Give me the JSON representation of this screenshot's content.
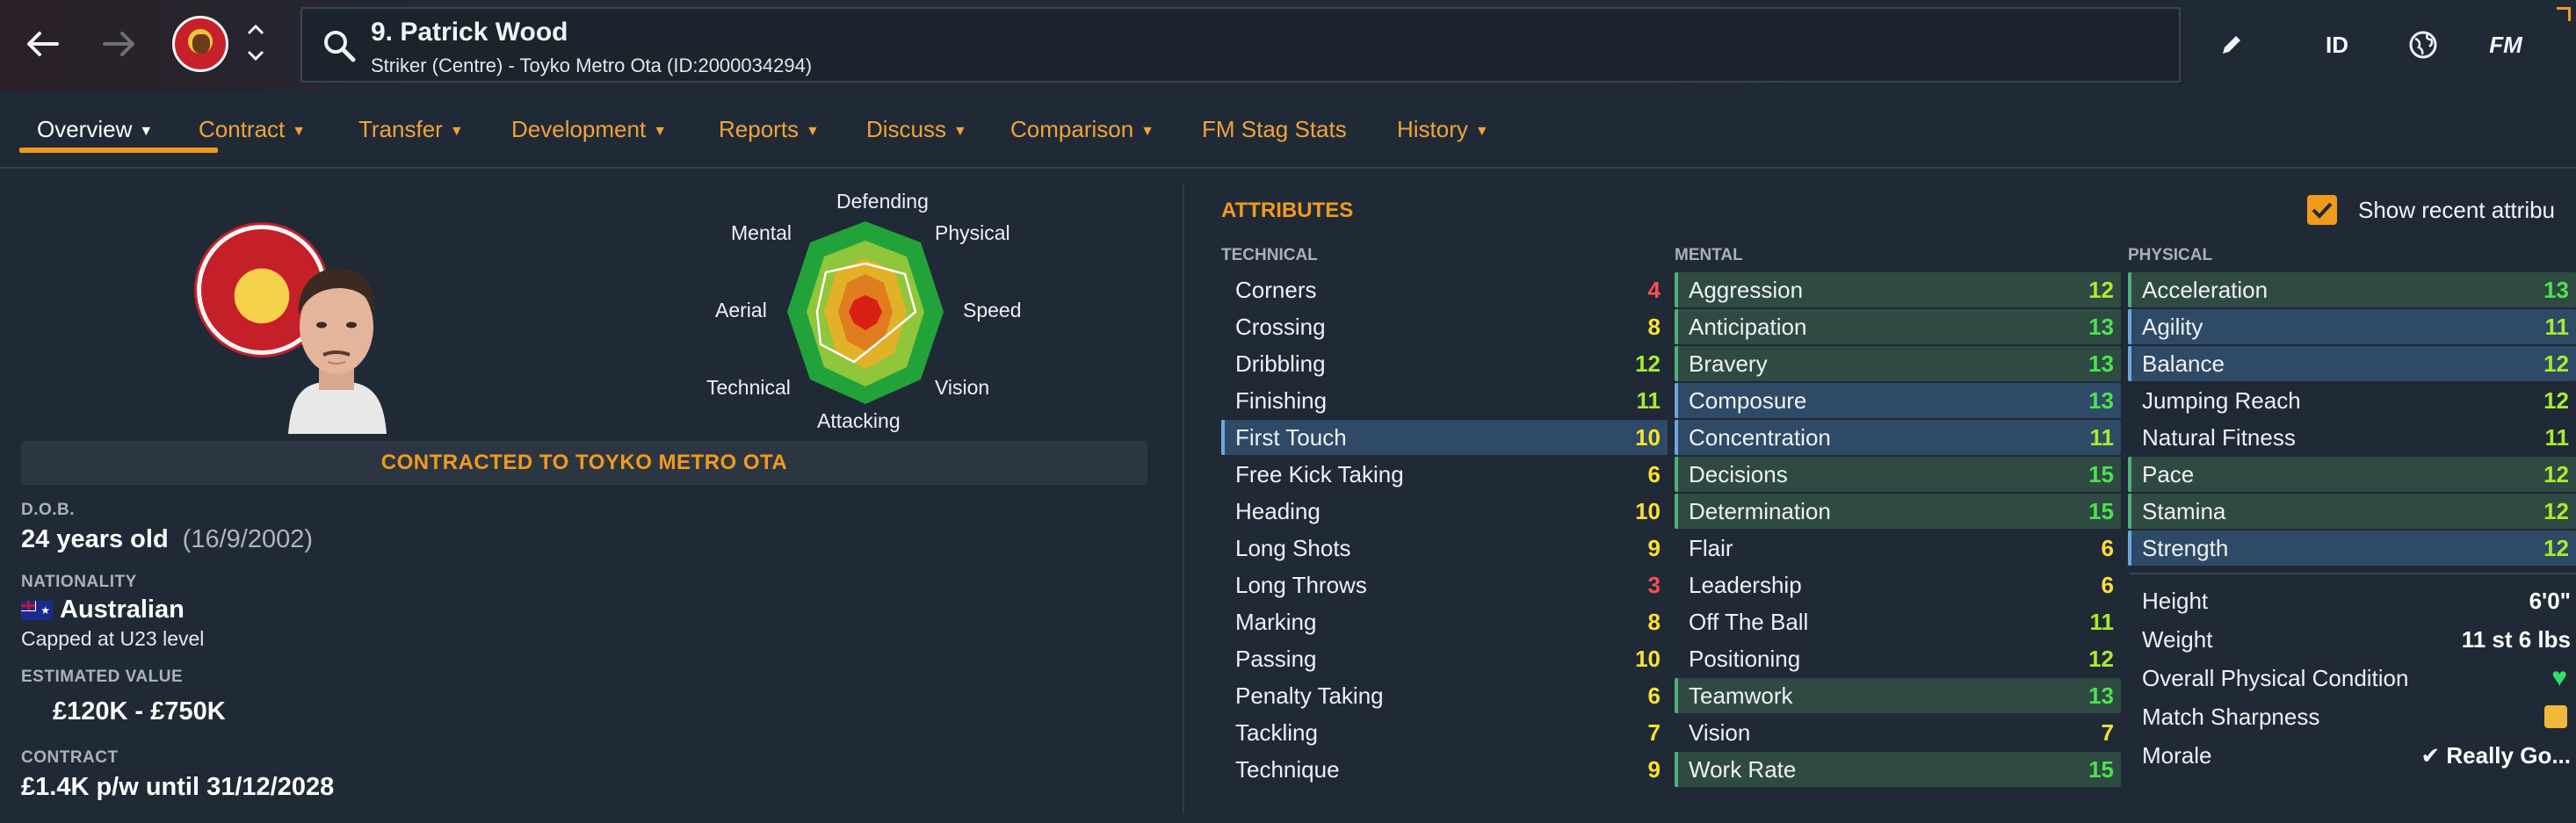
{
  "header": {
    "player_name": "9. Patrick Wood",
    "player_subtitle": "Striker (Centre) - Toyko Metro Ota (ID:2000034294)",
    "tools": {
      "id_label": "ID",
      "fm_label": "FM"
    },
    "icons": [
      "back-arrow-icon",
      "forward-arrow-icon",
      "club-badge",
      "chevron-up-icon",
      "chevron-down-icon",
      "search-icon",
      "pencil-icon",
      "globe-icon"
    ]
  },
  "tabs": [
    {
      "label": "Overview",
      "active": true
    },
    {
      "label": "Contract"
    },
    {
      "label": "Transfer"
    },
    {
      "label": "Development"
    },
    {
      "label": "Reports"
    },
    {
      "label": "Discuss"
    },
    {
      "label": "Comparison"
    },
    {
      "label": "FM Stag Stats"
    },
    {
      "label": "History"
    }
  ],
  "radar": {
    "labels": {
      "defending": "Defending",
      "physical": "Physical",
      "speed": "Speed",
      "vision": "Vision",
      "attacking": "Attacking",
      "technical": "Technical",
      "aerial": "Aerial",
      "mental": "Mental"
    }
  },
  "profile": {
    "contract_banner": "CONTRACTED TO TOYKO METRO OTA",
    "dob_label": "D.O.B.",
    "age": "24 years old",
    "dob": "(16/9/2002)",
    "nationality_label": "NATIONALITY",
    "nationality": "Australian",
    "caps": "Capped at U23 level",
    "value_label": "ESTIMATED VALUE",
    "value": "£120K - £750K",
    "contract_label": "CONTRACT",
    "contract": "£1.4K p/w until 31/12/2028"
  },
  "attributes": {
    "title": "ATTRIBUTES",
    "show_recent_label": "Show recent attribu",
    "show_recent_checked": true,
    "technical_label": "TECHNICAL",
    "mental_label": "MENTAL",
    "physical_label": "PHYSICAL",
    "technical": [
      {
        "name": "Corners",
        "value": "4"
      },
      {
        "name": "Crossing",
        "value": "8"
      },
      {
        "name": "Dribbling",
        "value": "12"
      },
      {
        "name": "Finishing",
        "value": "11"
      },
      {
        "name": "First Touch",
        "value": "10"
      },
      {
        "name": "Free Kick Taking",
        "value": "6"
      },
      {
        "name": "Heading",
        "value": "10"
      },
      {
        "name": "Long Shots",
        "value": "9"
      },
      {
        "name": "Long Throws",
        "value": "3"
      },
      {
        "name": "Marking",
        "value": "8"
      },
      {
        "name": "Passing",
        "value": "10"
      },
      {
        "name": "Penalty Taking",
        "value": "6"
      },
      {
        "name": "Tackling",
        "value": "7"
      },
      {
        "name": "Technique",
        "value": "9"
      }
    ],
    "mental": [
      {
        "name": "Aggression",
        "value": "12"
      },
      {
        "name": "Anticipation",
        "value": "13"
      },
      {
        "name": "Bravery",
        "value": "13"
      },
      {
        "name": "Composure",
        "value": "13"
      },
      {
        "name": "Concentration",
        "value": "11"
      },
      {
        "name": "Decisions",
        "value": "15"
      },
      {
        "name": "Determination",
        "value": "15"
      },
      {
        "name": "Flair",
        "value": "6"
      },
      {
        "name": "Leadership",
        "value": "6"
      },
      {
        "name": "Off The Ball",
        "value": "11"
      },
      {
        "name": "Positioning",
        "value": "12"
      },
      {
        "name": "Teamwork",
        "value": "13"
      },
      {
        "name": "Vision",
        "value": "7"
      },
      {
        "name": "Work Rate",
        "value": "15"
      }
    ],
    "physical": [
      {
        "name": "Acceleration",
        "value": "13"
      },
      {
        "name": "Agility",
        "value": "11"
      },
      {
        "name": "Balance",
        "value": "12"
      },
      {
        "name": "Jumping Reach",
        "value": "12"
      },
      {
        "name": "Natural Fitness",
        "value": "11"
      },
      {
        "name": "Pace",
        "value": "12"
      },
      {
        "name": "Stamina",
        "value": "12"
      },
      {
        "name": "Strength",
        "value": "12"
      }
    ],
    "physical_info": [
      {
        "name": "Height",
        "value": "6'0\""
      },
      {
        "name": "Weight",
        "value": "11 st 6 lbs"
      },
      {
        "name": "Overall Physical Condition",
        "value": ""
      },
      {
        "name": "Match Sharpness",
        "value": ""
      },
      {
        "name": "Morale",
        "value": "Really Go..."
      }
    ]
  },
  "colors": {
    "accent": "#f29a1a",
    "background": "#1f2a36",
    "value_red": "#ff4f4f",
    "value_yellow": "#ffe033",
    "value_light_green": "#a9ec2e",
    "value_green": "#4be34f",
    "highlight_blue": "#2e4a66",
    "highlight_green": "#2f4a42"
  }
}
